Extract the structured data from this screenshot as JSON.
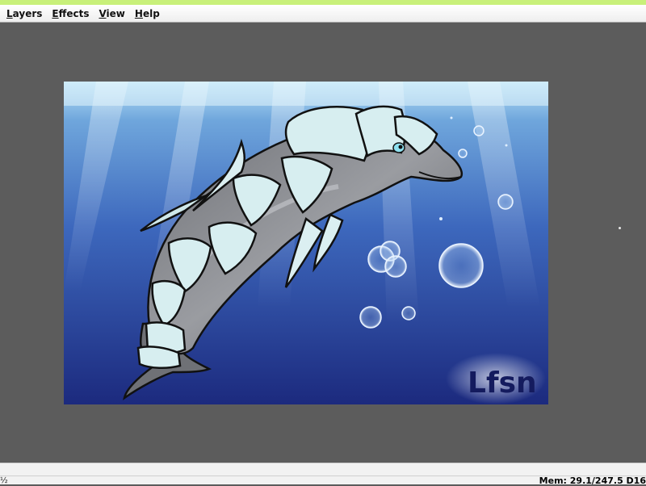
{
  "menubar": {
    "items": [
      {
        "label": "Layers"
      },
      {
        "label": "Effects"
      },
      {
        "label": "View"
      },
      {
        "label": "Help"
      }
    ]
  },
  "canvas": {
    "artwork": "dolphin-in-armor-underwater",
    "signature": "Lfsn",
    "colors": {
      "water_top": "#a9d6f2",
      "water_mid": "#3f6fc0",
      "water_bottom": "#1f2f86",
      "dolphin_body": "#8a8c90",
      "armor": "#d7eef0"
    }
  },
  "workspace": {
    "background": "#5c5c5c"
  },
  "statusbar": {
    "left_text": "½",
    "memory": "Mem: 29.1/247.5 D16"
  }
}
